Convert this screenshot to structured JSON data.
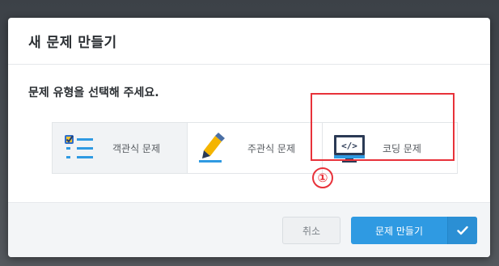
{
  "dialog": {
    "title": "새 문제 만들기",
    "prompt": "문제 유형을 선택해 주세요.",
    "options": [
      {
        "label": "객관식 문제",
        "icon": "checklist-icon",
        "selected": true
      },
      {
        "label": "주관식 문제",
        "icon": "pencil-icon",
        "selected": false
      },
      {
        "label": "코딩 문제",
        "icon": "code-monitor-icon",
        "selected": false
      }
    ],
    "annotation": {
      "marker": "①",
      "color": "#e8323a"
    }
  },
  "footer": {
    "cancel_label": "취소",
    "create_label": "문제 만들기",
    "create_icon": "check-icon"
  },
  "colors": {
    "primary": "#2f9ae2",
    "highlight": "#e8323a"
  }
}
